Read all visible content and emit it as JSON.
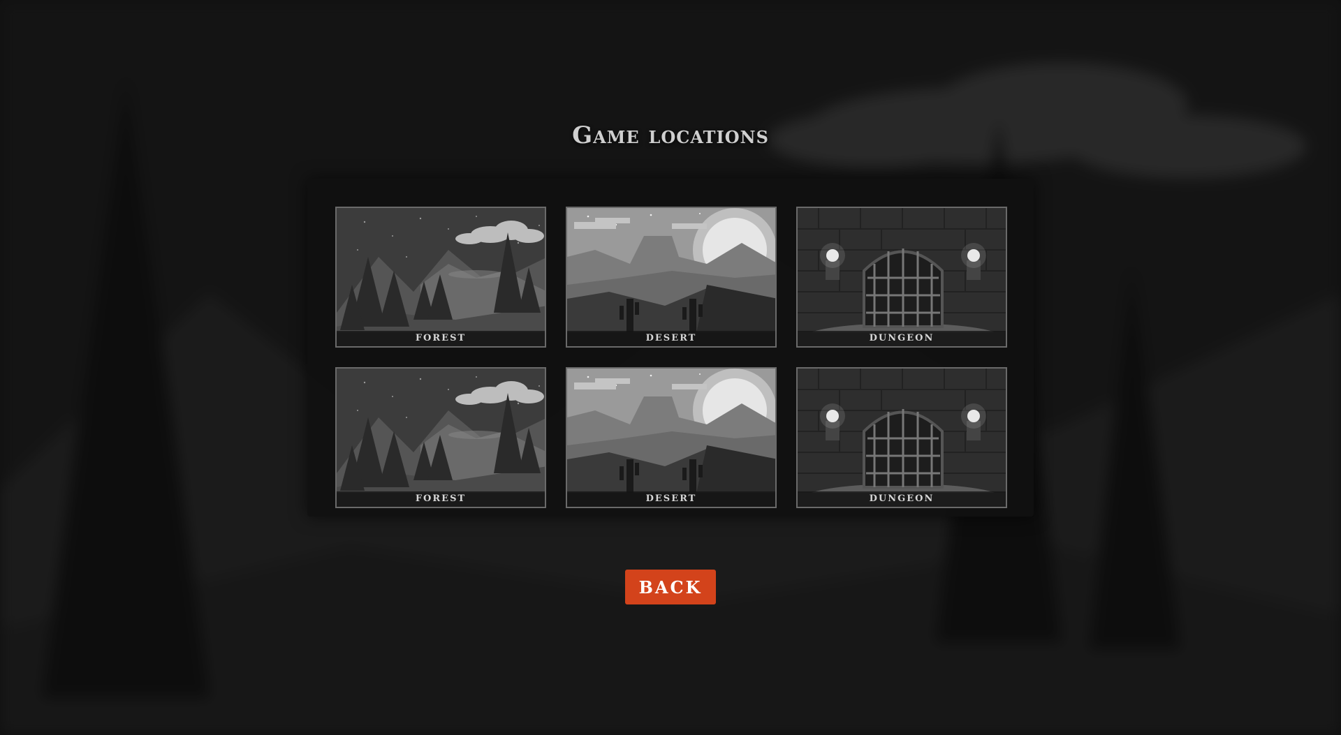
{
  "screen": {
    "title": "Game locations"
  },
  "locations": [
    {
      "label": "FOREST",
      "icon": "forest-scene"
    },
    {
      "label": "DESERT",
      "icon": "desert-scene"
    },
    {
      "label": "DUNGEON",
      "icon": "dungeon-scene"
    },
    {
      "label": "FOREST",
      "icon": "forest-scene"
    },
    {
      "label": "DESERT",
      "icon": "desert-scene"
    },
    {
      "label": "DUNGEON",
      "icon": "dungeon-scene"
    }
  ],
  "back_button": {
    "label": "BACK"
  },
  "colors": {
    "accent": "#d3431b",
    "panel": "#101010",
    "text": "#cfcfcf"
  }
}
